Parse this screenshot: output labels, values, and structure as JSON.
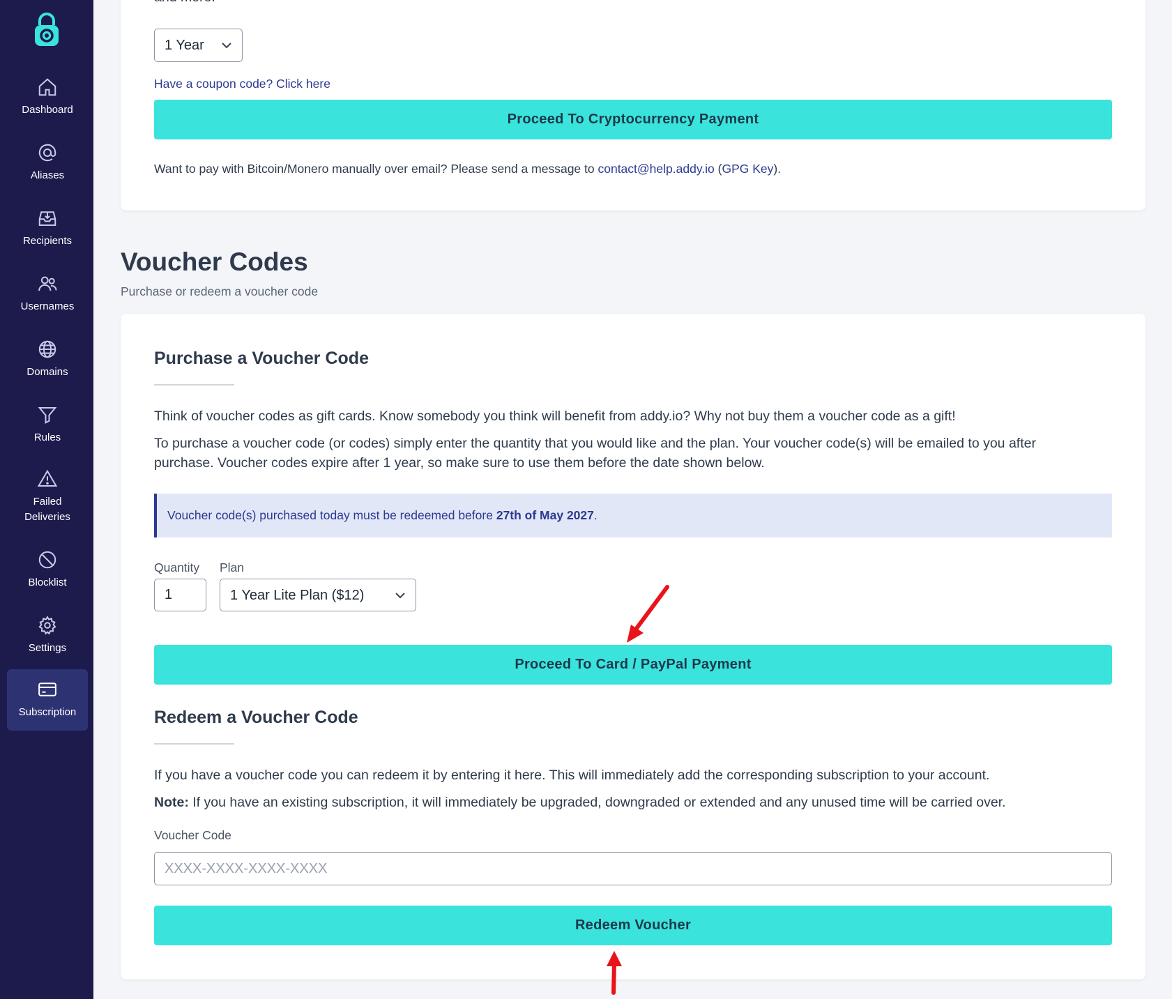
{
  "sidebar": {
    "items": [
      {
        "label": "Dashboard",
        "icon": "home-icon"
      },
      {
        "label": "Aliases",
        "icon": "at-sign-icon"
      },
      {
        "label": "Recipients",
        "icon": "inbox-download-icon"
      },
      {
        "label": "Usernames",
        "icon": "users-icon"
      },
      {
        "label": "Domains",
        "icon": "globe-icon"
      },
      {
        "label": "Rules",
        "icon": "filter-icon"
      },
      {
        "label": "Failed",
        "label2": "Deliveries",
        "icon": "warning-triangle-icon"
      },
      {
        "label": "Blocklist",
        "icon": "block-icon"
      },
      {
        "label": "Settings",
        "icon": "gear-icon"
      },
      {
        "label": "Subscription",
        "icon": "credit-card-icon",
        "active": true
      }
    ]
  },
  "crypto": {
    "partial_text": "and more.",
    "duration_value": "1 Year",
    "coupon_link": "Have a coupon code? Click here",
    "proceed_label": "Proceed To Cryptocurrency Payment",
    "manual_text": "Want to pay with Bitcoin/Monero manually over email? Please send a message to ",
    "email_link": "contact@help.addy.io",
    "paren_open": " (",
    "gpg_link": "GPG Key",
    "paren_close": ")."
  },
  "voucher": {
    "title": "Voucher Codes",
    "subtitle": "Purchase or redeem a voucher code",
    "purchase": {
      "heading": "Purchase a Voucher Code",
      "para1": "Think of voucher codes as gift cards. Know somebody you think will benefit from addy.io? Why not buy them a voucher code as a gift!",
      "para2_line1": "To purchase a voucher code (or codes) simply enter the quantity that you would like and the plan. Your voucher code(s) will be emailed to you after",
      "para2_line2": "purchase. Voucher codes expire after 1 year, so make sure to use them before the date shown below.",
      "notice_text": "Voucher code(s) purchased today must be redeemed before ",
      "notice_date": "27th of May 2027",
      "notice_end": ".",
      "quantity_label": "Quantity",
      "quantity_value": "1",
      "plan_label": "Plan",
      "plan_value": "1 Year Lite Plan ($12)",
      "proceed_label": "Proceed To Card / PayPal Payment"
    },
    "redeem": {
      "heading": "Redeem a Voucher Code",
      "para1": "If you have a voucher code you can redeem it by entering it here. This will immediately add the corresponding subscription to your account.",
      "note_label": "Note:",
      "note_text": " If you have an existing subscription, it will immediately be upgraded, downgraded or extended and any unused time will be carried over.",
      "code_label": "Voucher Code",
      "code_placeholder": "XXXX-XXXX-XXXX-XXXX",
      "redeem_label": "Redeem Voucher"
    }
  },
  "colors": {
    "sidebar_bg": "#1d1b4c",
    "accent_button": "#3be3dd",
    "link": "#2b3a8f",
    "annotation_arrow": "#e8141a"
  }
}
